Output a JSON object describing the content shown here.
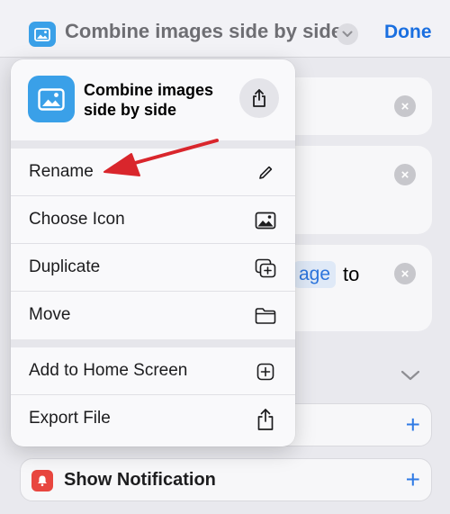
{
  "header": {
    "title": "Combine images side by side",
    "done_label": "Done"
  },
  "cards": {
    "token_text": "age",
    "trailing_text": "to"
  },
  "actions": {
    "notification_label": "Show Notification"
  },
  "menu": {
    "title": "Combine images side by side",
    "items": [
      {
        "label": "Rename",
        "icon": "pencil-icon"
      },
      {
        "label": "Choose Icon",
        "icon": "image-icon"
      },
      {
        "label": "Duplicate",
        "icon": "duplicate-icon"
      },
      {
        "label": "Move",
        "icon": "folder-icon"
      },
      {
        "label": "Add to Home Screen",
        "icon": "add-square-icon"
      },
      {
        "label": "Export File",
        "icon": "share-icon"
      }
    ]
  },
  "colors": {
    "accent": "#1a6fe0",
    "shortcut_icon": "#3aa0e8",
    "annotation_arrow": "#d9262c",
    "notification_icon": "#e8463f"
  }
}
